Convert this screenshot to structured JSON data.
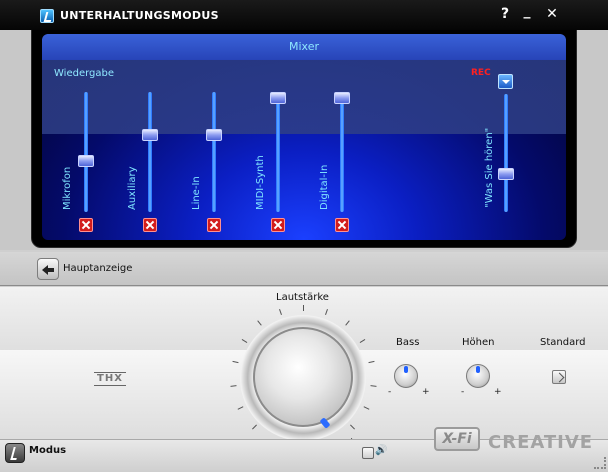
{
  "window": {
    "title": "UNTERHALTUNGSMODUS",
    "help_label": "?",
    "minimize_label": "_",
    "close_label": "✕"
  },
  "mixer": {
    "title": "Mixer",
    "section_playback": "Wiedergabe",
    "section_record": "REC",
    "channels": [
      {
        "label": "Mikrofon",
        "level": 0.42,
        "muted": true
      },
      {
        "label": "Auxiliary",
        "level": 0.66,
        "muted": true
      },
      {
        "label": "Line-In",
        "level": 0.66,
        "muted": true
      },
      {
        "label": "MIDI-Synth",
        "level": 1.0,
        "muted": true
      },
      {
        "label": "Digital-In",
        "level": 1.0,
        "muted": true
      }
    ],
    "record_channel": {
      "label": "\"Was Sie hören\"",
      "level": 0.3
    }
  },
  "navigation": {
    "back_label": "Hauptanzeige"
  },
  "controls": {
    "volume_label": "Lautstärke",
    "volume_min_label": "-",
    "volume_max_label": "+",
    "bass_label": "Bass",
    "treble_label": "Höhen",
    "standard_label": "Standard",
    "minus": "-",
    "plus": "+"
  },
  "branding": {
    "thx": "THX",
    "xfi": "X-Fi",
    "creative": "CREATIVE"
  },
  "footer": {
    "mode_label": "Modus",
    "speaker_glyph": "🔊"
  },
  "colors": {
    "accent": "#1d6bff",
    "mute": "#d21c1c",
    "rec": "#ff2020",
    "label_cyan": "#7fe4ff"
  }
}
